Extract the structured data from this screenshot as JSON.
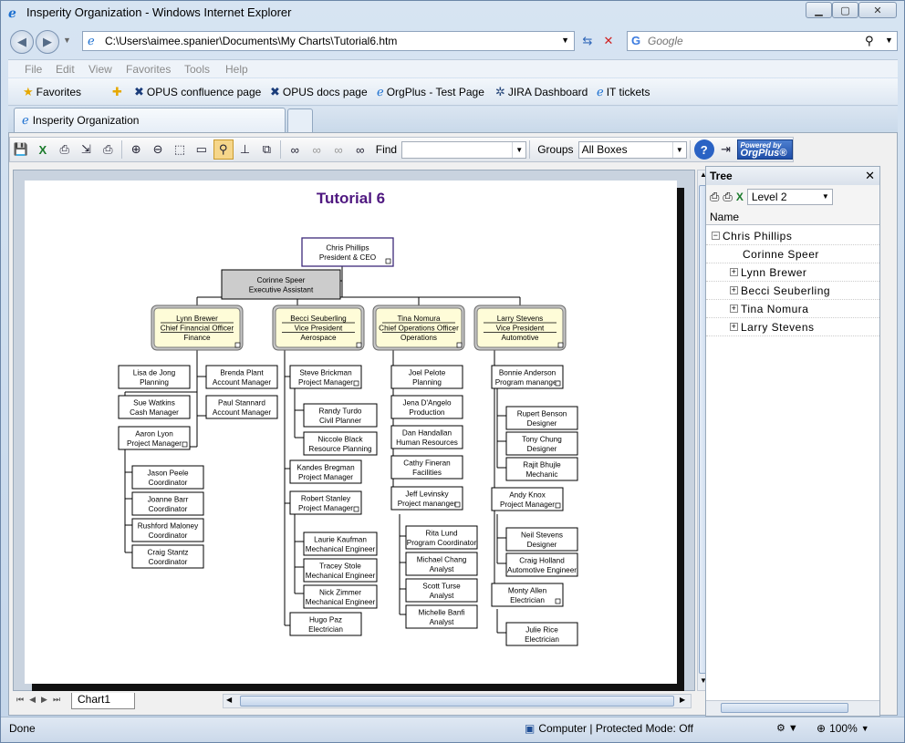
{
  "window": {
    "title": "Insperity Organization - Windows Internet Explorer"
  },
  "address": {
    "url": "C:\\Users\\aimee.spanier\\Documents\\My Charts\\Tutorial6.htm",
    "search_placeholder": "Google"
  },
  "menu": [
    "File",
    "Edit",
    "View",
    "Favorites",
    "Tools",
    "Help"
  ],
  "favorites": {
    "label": "Favorites",
    "links": [
      "OPUS confluence page",
      "OPUS docs page",
      "OrgPlus - Test Page",
      "JIRA Dashboard",
      "IT tickets"
    ]
  },
  "tab": {
    "label": "Insperity Organization"
  },
  "toolbar": {
    "find_label": "Find",
    "find_value": "",
    "groups_label": "Groups",
    "groups_value": "All Boxes",
    "powered_line1": "Powered by",
    "powered_line2": "OrgPlus®"
  },
  "chart_title": "Tutorial 6",
  "org": {
    "ceo": [
      "Chris  Phillips",
      "President & CEO"
    ],
    "assistant": [
      "Corinne  Speer",
      "Executive Assistant"
    ],
    "vps": [
      [
        "Lynn  Brewer",
        "Chief Financial Officer",
        "Finance"
      ],
      [
        "Becci  Seuberling",
        "Vice President",
        "Aerospace"
      ],
      [
        "Tina  Nomura",
        "Chief Operations Officer",
        "Operations"
      ],
      [
        "Larry  Stevens",
        "Vice President",
        "Automotive"
      ]
    ],
    "boxes": [
      [
        "Lisa de Jong",
        "Planning"
      ],
      [
        "Sue  Watkins",
        "Cash Manager"
      ],
      [
        "Aaron  Lyon",
        "Project Manager"
      ],
      [
        "Brenda  Plant",
        "Account Manager"
      ],
      [
        "Paul  Stannard",
        "Account Manager"
      ],
      [
        "Jason  Peele",
        "Coordinator"
      ],
      [
        "Joanne  Barr",
        "Coordinator"
      ],
      [
        "Rushford  Maloney",
        "Coordinator"
      ],
      [
        "Craig  Stantz",
        "Coordinator"
      ],
      [
        "Steve  Brickman",
        "Project Manager"
      ],
      [
        "Randy  Turdo",
        "Civil Planner"
      ],
      [
        "Niccole  Black",
        "Resource Planning"
      ],
      [
        "Kandes  Bregman",
        "Project Manager"
      ],
      [
        "Robert  Stanley",
        "Project Manager"
      ],
      [
        "Laurie  Kaufman",
        "Mechanical Engineer"
      ],
      [
        "Tracey  Stole",
        "Mechanical Engineer"
      ],
      [
        "Nick  Zimmer",
        "Mechanical Engineer"
      ],
      [
        "Hugo  Paz",
        "Electrician"
      ],
      [
        "Joel  Pelote",
        "Planning"
      ],
      [
        "Jena  D'Angelo",
        "Production"
      ],
      [
        "Dan  Handallan",
        "Human Resources"
      ],
      [
        "Cathy  Fineran",
        "Facilities"
      ],
      [
        "Jeff  Levinsky",
        "Project mananger"
      ],
      [
        "Rita  Lund",
        "Program Coordinator"
      ],
      [
        "Michael  Chang",
        "Analyst"
      ],
      [
        "Scott  Turse",
        "Analyst"
      ],
      [
        "Michelle  Banfi",
        "Analyst"
      ],
      [
        "Bonnie  Anderson",
        "Program mananger"
      ],
      [
        "Rupert  Benson",
        "Designer"
      ],
      [
        "Tony  Chung",
        "Designer"
      ],
      [
        "Rajit  Bhujle",
        "Mechanic"
      ],
      [
        "Andy  Knox",
        "Project Manager"
      ],
      [
        "Neil  Stevens",
        "Designer"
      ],
      [
        "Craig  Holland",
        "Automotive Engineer"
      ],
      [
        "Monty  Allen",
        "Electrician"
      ],
      [
        "Julie  Rice",
        "Electrician"
      ]
    ]
  },
  "sheet_tab": "Chart1",
  "tree": {
    "title": "Tree",
    "level": "Level 2",
    "column": "Name",
    "root": "Chris  Phillips",
    "items": [
      "Corinne  Speer",
      "Lynn  Brewer",
      "Becci  Seuberling",
      "Tina  Nomura",
      "Larry  Stevens"
    ]
  },
  "status": {
    "text": "Done",
    "zone": "Computer | Protected Mode: Off",
    "zoom": "100%"
  }
}
